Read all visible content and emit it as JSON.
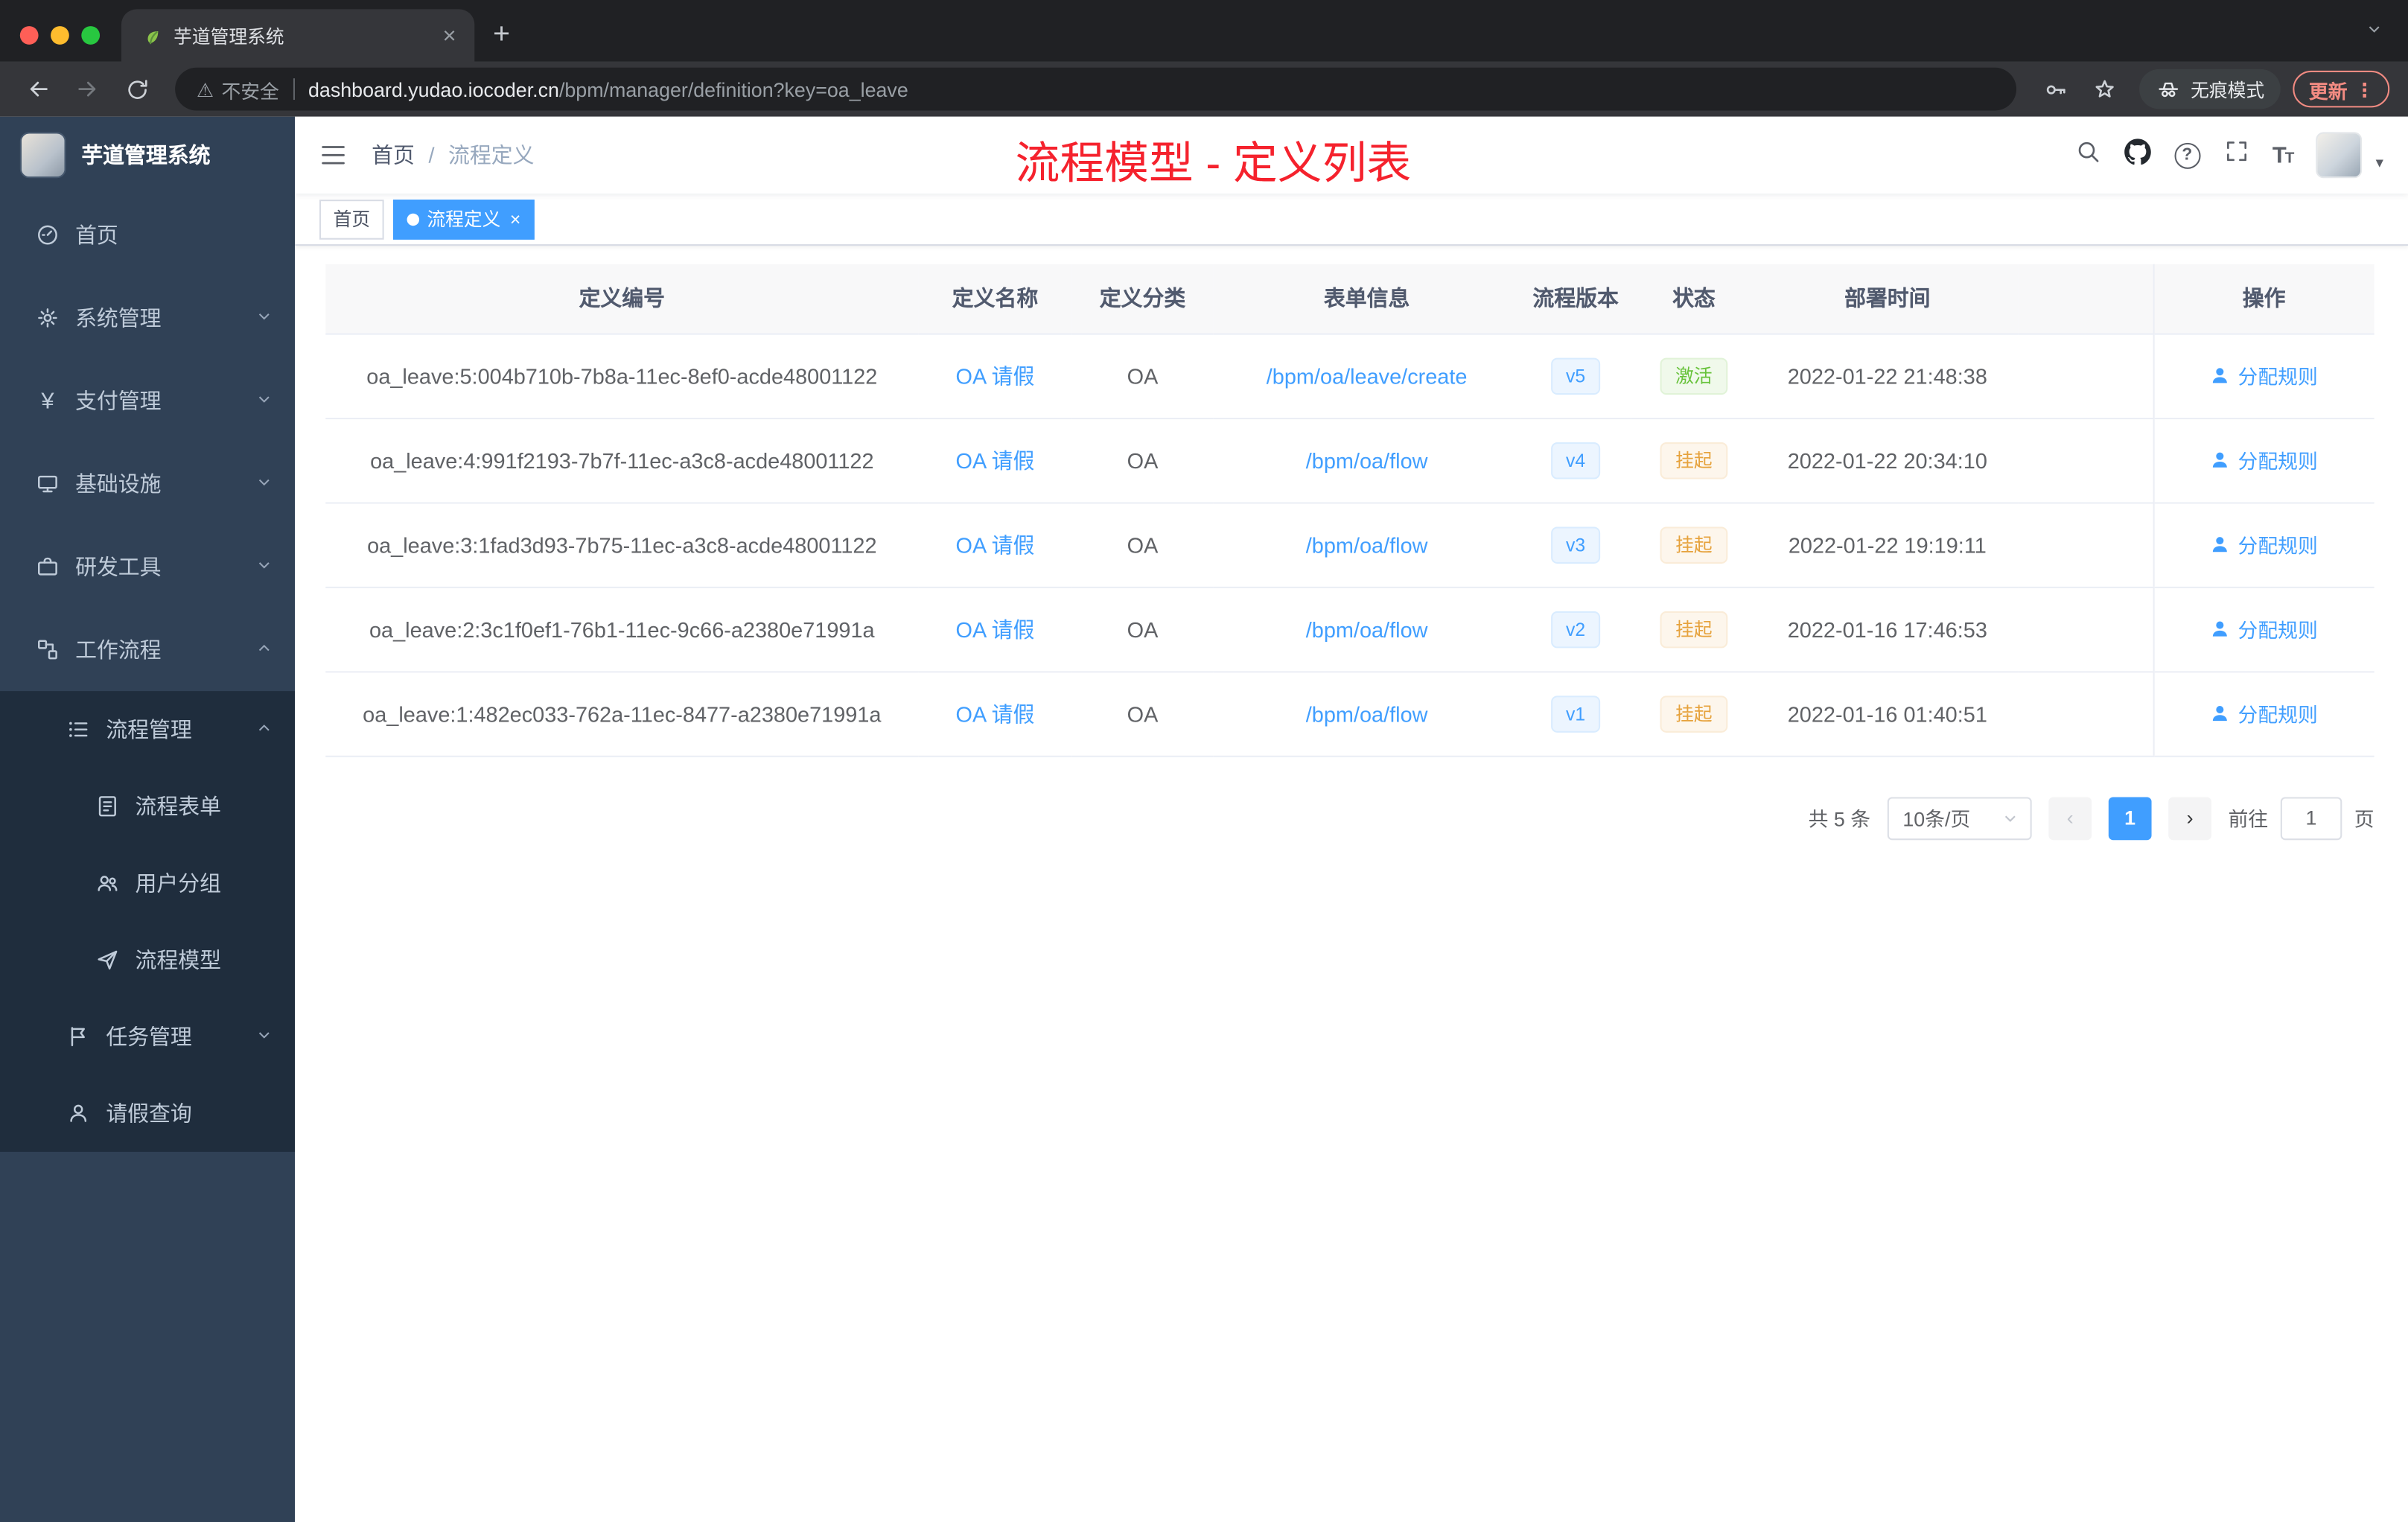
{
  "glyphs": {
    "close": "×",
    "plus": "+",
    "dots": "⋮",
    "caret": "▾",
    "warning": "⚠",
    "prev": "‹",
    "next": "›",
    "question": "?",
    "yen": "¥",
    "pipe": "×"
  },
  "browser": {
    "tab_title": "芋道管理系统",
    "security_text": "不安全",
    "url_host": "dashboard.yudao.iocoder.cn",
    "url_path": "/bpm/manager/definition?key=oa_leave",
    "incognito_label": "无痕模式",
    "update_label": "更新"
  },
  "sidebar": {
    "title": "芋道管理系统",
    "menu": {
      "home": "首页",
      "system": "系统管理",
      "pay": "支付管理",
      "infra": "基础设施",
      "dev": "研发工具",
      "workflow": "工作流程",
      "process_mgmt": "流程管理",
      "process_form": "流程表单",
      "user_group": "用户分组",
      "process_model": "流程模型",
      "task_mgmt": "任务管理",
      "leave_query": "请假查询"
    }
  },
  "header": {
    "breadcrumb_home": "首页",
    "breadcrumb_sep": "/",
    "breadcrumb_current": "流程定义",
    "annotation": "流程模型 - 定义列表",
    "annotation_color": "#f5222d"
  },
  "tags": {
    "home": "首页",
    "current": "流程定义"
  },
  "table": {
    "columns": [
      "定义编号",
      "定义名称",
      "定义分类",
      "表单信息",
      "流程版本",
      "状态",
      "部署时间",
      "操作"
    ],
    "rows": [
      {
        "id": "oa_leave:5:004b710b-7b8a-11ec-8ef0-acde48001122",
        "name": "OA 请假",
        "category": "OA",
        "form": "/bpm/oa/leave/create",
        "version": "v5",
        "status": "激活",
        "status_type": "success",
        "time": "2022-01-22 21:48:38",
        "action": "分配规则"
      },
      {
        "id": "oa_leave:4:991f2193-7b7f-11ec-a3c8-acde48001122",
        "name": "OA 请假",
        "category": "OA",
        "form": "/bpm/oa/flow",
        "version": "v4",
        "status": "挂起",
        "status_type": "warning",
        "time": "2022-01-22 20:34:10",
        "action": "分配规则"
      },
      {
        "id": "oa_leave:3:1fad3d93-7b75-11ec-a3c8-acde48001122",
        "name": "OA 请假",
        "category": "OA",
        "form": "/bpm/oa/flow",
        "version": "v3",
        "status": "挂起",
        "status_type": "warning",
        "time": "2022-01-22 19:19:11",
        "action": "分配规则"
      },
      {
        "id": "oa_leave:2:3c1f0ef1-76b1-11ec-9c66-a2380e71991a",
        "name": "OA 请假",
        "category": "OA",
        "form": "/bpm/oa/flow",
        "version": "v2",
        "status": "挂起",
        "status_type": "warning",
        "time": "2022-01-16 17:46:53",
        "action": "分配规则"
      },
      {
        "id": "oa_leave:1:482ec033-762a-11ec-8477-a2380e71991a",
        "name": "OA 请假",
        "category": "OA",
        "form": "/bpm/oa/flow",
        "version": "v1",
        "status": "挂起",
        "status_type": "warning",
        "time": "2022-01-16 01:40:51",
        "action": "分配规则"
      }
    ]
  },
  "pagination": {
    "total": "共 5 条",
    "page_size": "10条/页",
    "current_page": "1",
    "goto_label": "前往",
    "goto_value": "1",
    "page_unit": "页"
  },
  "colors": {
    "primary": "#409eff",
    "success": "#67c23a",
    "warning": "#e6a23c",
    "annotation_red": "#f5222d",
    "sidebar_bg": "#304156",
    "submenu_bg": "#1f2d3d"
  }
}
